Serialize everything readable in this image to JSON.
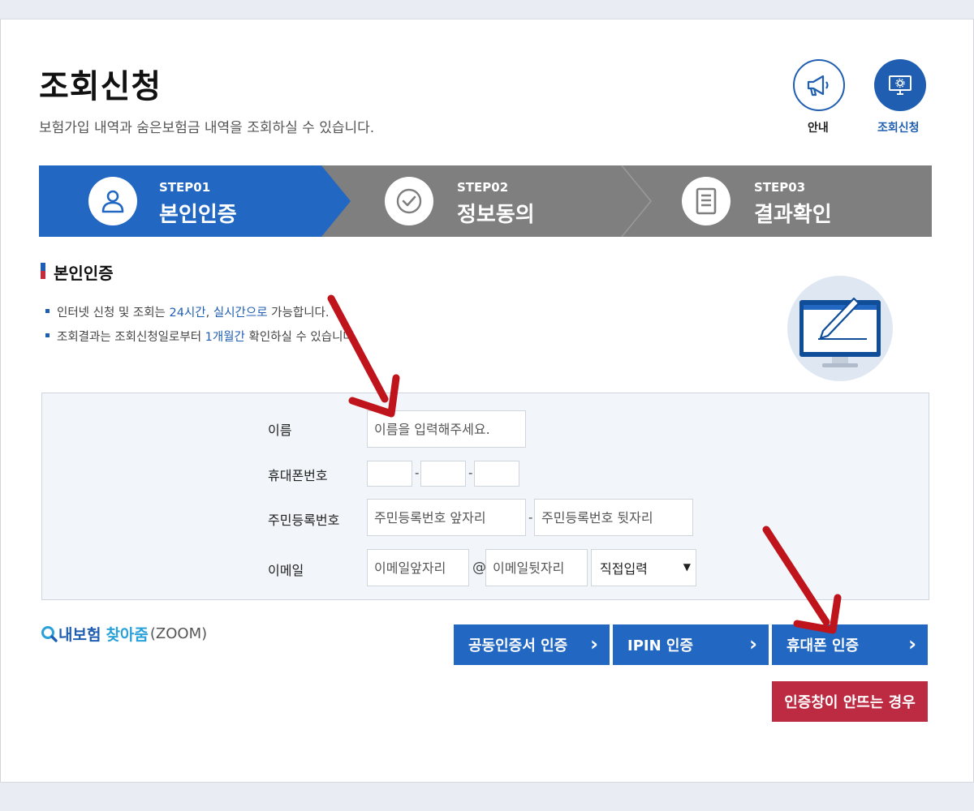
{
  "page": {
    "title": "조회신청",
    "description": "보험가입 내역과 숨은보험금 내역을 조회하실 수 있습니다."
  },
  "top_icons": {
    "guide_label": "안내",
    "apply_label": "조회신청"
  },
  "steps": [
    {
      "number": "STEP01",
      "label": "본인인증",
      "active": true
    },
    {
      "number": "STEP02",
      "label": "정보동의",
      "active": false
    },
    {
      "number": "STEP03",
      "label": "결과확인",
      "active": false
    }
  ],
  "section": {
    "title": "본인인증",
    "bullet1": {
      "pre": "인터넷 신청 및 조회는 ",
      "hl1": "24시간",
      "mid": ", ",
      "hl2": "실시간으로",
      "post": " 가능합니다."
    },
    "bullet2": {
      "pre": "조회결과는 조회신청일로부터 ",
      "hl1": "1개월간",
      "post": " 확인하실 수 있습니다."
    }
  },
  "form": {
    "name_label": "이름",
    "name_placeholder": "이름을 입력해주세요.",
    "phone_label": "휴대폰번호",
    "phone_sep": "-",
    "rrn_label": "주민등록번호",
    "rrn_front_placeholder": "주민등록번호 앞자리",
    "rrn_back_placeholder": "주민등록번호 뒷자리",
    "rrn_sep": "-",
    "email_label": "이메일",
    "email_front_placeholder": "이메일앞자리",
    "email_at": "@",
    "email_back_placeholder": "이메일뒷자리",
    "email_domain_selected": "직접입력"
  },
  "logo": {
    "part1": "내보험",
    "part2": "찾아줌",
    "part3": "(ZOOM)"
  },
  "buttons": {
    "cert": "공동인증서 인증",
    "ipin": "IPIN 인증",
    "phone": "휴대폰 인증",
    "arrow": "›",
    "popup_fail": "인증창이 안뜨는 경우"
  },
  "colors": {
    "primary": "#2268c2",
    "step_inactive": "#7f7f7f",
    "danger": "#bd2b43",
    "annotation_arrow": "#c0141c"
  },
  "icons": {
    "guide": "megaphone-icon",
    "apply": "monitor-gear-icon",
    "step1": "user-icon",
    "step2": "check-circle-icon",
    "step3": "document-icon",
    "search": "search-icon"
  }
}
